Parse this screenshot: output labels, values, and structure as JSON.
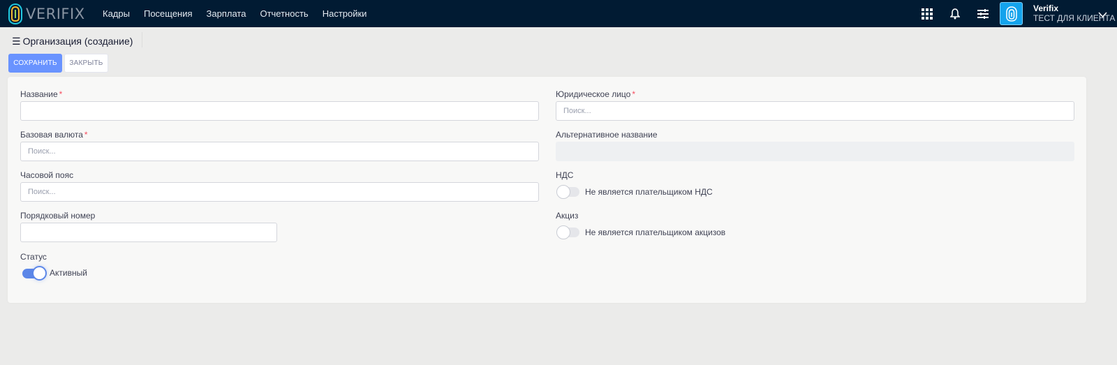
{
  "brand": {
    "name": "VERIFIX"
  },
  "nav": {
    "items": [
      {
        "label": "Кадры"
      },
      {
        "label": "Посещения"
      },
      {
        "label": "Зарплата"
      },
      {
        "label": "Отчетность"
      },
      {
        "label": "Настройки"
      }
    ]
  },
  "header_right": {
    "icons": [
      "grid-icon",
      "bell-icon",
      "sliders-icon"
    ],
    "user_name": "Verifix",
    "user_org": "ТЕСТ ДЛЯ КЛИЕНТА"
  },
  "page": {
    "title": "Организация (создание)",
    "save_label": "СОХРАНИТЬ",
    "close_label": "ЗАКРЫТЬ"
  },
  "form": {
    "name": {
      "label": "Название",
      "required": "*",
      "value": ""
    },
    "legal_entity": {
      "label": "Юридическое лицо",
      "required": "*",
      "placeholder": "Поиск..."
    },
    "base_currency": {
      "label": "Базовая валюта",
      "required": "*",
      "placeholder": "Поиск..."
    },
    "alt_name": {
      "label": "Альтернативное название",
      "value": ""
    },
    "timezone": {
      "label": "Часовой пояс",
      "placeholder": "Поиск..."
    },
    "vat": {
      "label": "НДС",
      "toggle_text": "Не является плательщиком НДС",
      "enabled": false
    },
    "order_no": {
      "label": "Порядковый номер",
      "value": ""
    },
    "excise": {
      "label": "Акциз",
      "toggle_text": "Не является плательщиком акцизов",
      "enabled": false
    },
    "status": {
      "label": "Статус",
      "toggle_text": "Активный",
      "enabled": true
    }
  },
  "colors": {
    "navbar": "#011b33",
    "primary": "#6993ff",
    "toggle_on": "#5c87e8",
    "required": "#f64e60"
  }
}
